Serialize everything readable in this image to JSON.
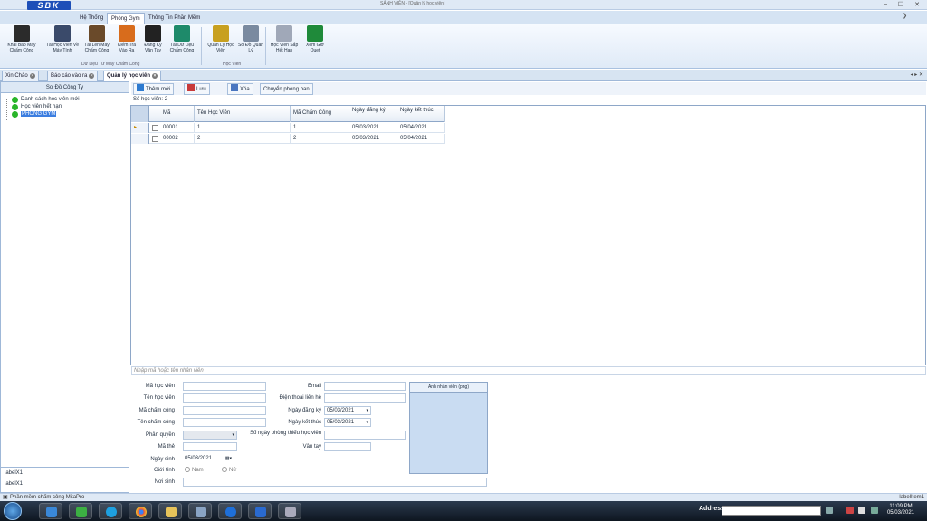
{
  "app": {
    "window_title": "SẢNH VIÊN - [Quản lý học viên]",
    "logo": "SBK"
  },
  "top_menu": {
    "items": [
      "Hệ Thống",
      "Phòng Gym",
      "Thông Tin Phần Mềm"
    ],
    "active": "Phòng Gym"
  },
  "ribbon": {
    "buttons": [
      {
        "label": "Khai Báo Máy Chấm Công",
        "icon": "fingerprint-machine-icon",
        "color": "#2b2b2b"
      },
      {
        "label": "Tải Học Viên Về Máy Tính",
        "icon": "users-download-icon",
        "color": "#3a4a6a"
      },
      {
        "label": "Tải Lên Máy Chấm Công",
        "icon": "users-upload-icon",
        "color": "#6a4a2a"
      },
      {
        "label": "Kiểm Tra Vào Ra",
        "icon": "check-inout-icon",
        "color": "#d86c1c"
      },
      {
        "label": "Đăng Ký Vân Tay",
        "icon": "fingerprint-icon",
        "color": "#222222"
      },
      {
        "label": "Tải Dữ Liệu Chấm Công",
        "icon": "data-download-icon",
        "color": "#1e8a6a"
      },
      {
        "label": "Quản Lý Học Viên",
        "icon": "user-manage-icon",
        "color": "#c8a020"
      },
      {
        "label": "Sơ Đồ Quản Lý",
        "icon": "org-chart-icon",
        "color": "#7a8aa0"
      },
      {
        "label": "Học Viên Sắp Hết Hạn",
        "icon": "document-icon",
        "color": "#a0a8b8"
      },
      {
        "label": "Xem Giờ Quẹt",
        "icon": "excel-icon",
        "color": "#1f8a3a"
      }
    ],
    "groups": [
      "Dữ Liệu Từ Máy Chấm Công",
      "Học Viên"
    ]
  },
  "doc_tabs": [
    {
      "label": "Xin Chào"
    },
    {
      "label": "Báo cáo vào ra"
    },
    {
      "label": "Quản lý học viên",
      "active": true
    }
  ],
  "left_pane": {
    "title": "Sơ Đồ Công Ty",
    "tree": [
      {
        "label": "Danh sách học viên mới"
      },
      {
        "label": "Học viên hết hạn"
      },
      {
        "label": "PHÒNG GYM",
        "selected": true
      }
    ],
    "footer_labels": [
      "labelX1",
      "labelX1"
    ]
  },
  "toolbar": {
    "new": "Thêm mới",
    "save": "Lưu",
    "delete": "Xóa",
    "transfer": "Chuyển phòng ban"
  },
  "grid": {
    "count_label": "Số học viên: 2",
    "columns": [
      "Mã",
      "Tên Học Viên",
      "Mã Chấm Công",
      "Ngày đăng ký",
      "Ngày kết thúc"
    ],
    "rows": [
      [
        "00001",
        "1",
        "1",
        "05/03/2021",
        "05/04/2021"
      ],
      [
        "00002",
        "2",
        "2",
        "05/03/2021",
        "05/04/2021"
      ]
    ]
  },
  "search": {
    "placeholder": "Nhập mã hoặc tên nhân viên"
  },
  "form": {
    "ma_hoc_vien": "Mã học viên",
    "ten_hoc_vien": "Tên học viên",
    "ma_cham_cong": "Mã chấm công",
    "ten_cham_cong": "Tên chấm công",
    "phan_quyen": "Phân quyền",
    "ma_the": "Mã thẻ",
    "ngay_sinh": "Ngày sinh",
    "ngay_sinh_value": "05/03/2021",
    "gioi_tinh": "Giới tính",
    "nam": "Nam",
    "nu": "Nữ",
    "noi_sinh": "Nơi sinh",
    "email": "Email",
    "dien_thoai": "Điện thoại liên hệ",
    "ngay_dang_ky": "Ngày đăng ký",
    "ngay_dang_ky_value": "05/03/2021",
    "ngay_ket_thuc": "Ngày kết thúc",
    "ngay_ket_thuc_value": "05/03/2021",
    "so_ngay_phong": "Số ngày phòng thiếu học viên",
    "van_tay": "Vân tay",
    "photo_title": "Ảnh nhân viên (png)"
  },
  "status": {
    "left": "Phần mềm chấm công MitaPro",
    "right": "labelItem1"
  },
  "taskbar": {
    "address_label": "Address",
    "time": "11:09 PM",
    "date": "05/03/2021"
  }
}
